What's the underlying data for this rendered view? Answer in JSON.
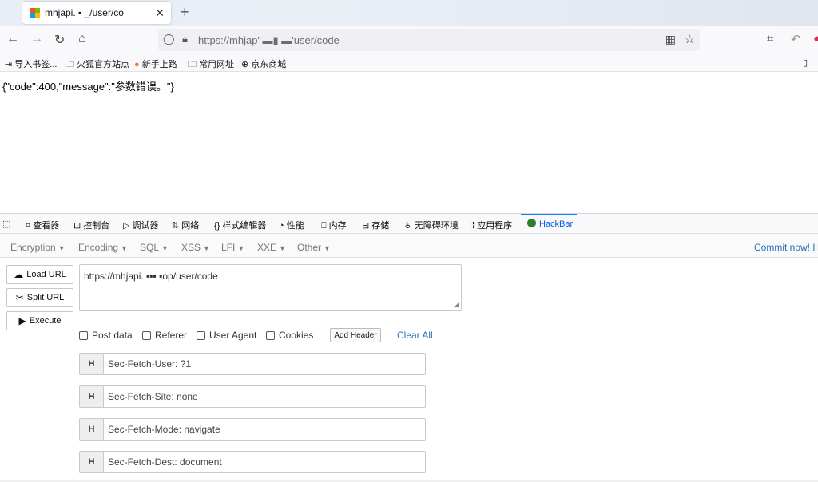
{
  "browser": {
    "tab": {
      "title": "mhjapi.  ▪    _/user/co",
      "favicon_colors": [
        "#f25022",
        "#7fba00",
        "#00a4ef",
        "#ffb900"
      ]
    },
    "url": "https://mhjap'       ▬▮  ▬'user/code",
    "bookmarks": [
      "导入书签...",
      "火狐官方站点",
      "新手上路",
      "常用网址",
      "京东商城"
    ]
  },
  "page": {
    "response": "{\"code\":400,\"message\":\"参数错误。\"}"
  },
  "devtools": {
    "tabs": [
      "查看器",
      "控制台",
      "调试器",
      "网络",
      "样式编辑器",
      "性能",
      "内存",
      "存储",
      "无障碍环境",
      "应用程序",
      "HackBar"
    ],
    "active_tab": "HackBar"
  },
  "hackbar": {
    "menu": [
      "Encryption",
      "Encoding",
      "SQL",
      "XSS",
      "LFI",
      "XXE",
      "Other"
    ],
    "commit": "Commit now! H",
    "buttons": {
      "load": "Load URL",
      "split": "Split URL",
      "execute": "Execute"
    },
    "url_value": "https://mhjapi.    ▪▪▪  ▪op/user/code",
    "options": [
      "Post data",
      "Referer",
      "User Agent",
      "Cookies"
    ],
    "add_header": "Add Header",
    "clear_all": "Clear All",
    "header_label": "H",
    "headers": [
      "Sec-Fetch-User: ?1",
      "Sec-Fetch-Site: none",
      "Sec-Fetch-Mode: navigate",
      "Sec-Fetch-Dest: document"
    ]
  }
}
